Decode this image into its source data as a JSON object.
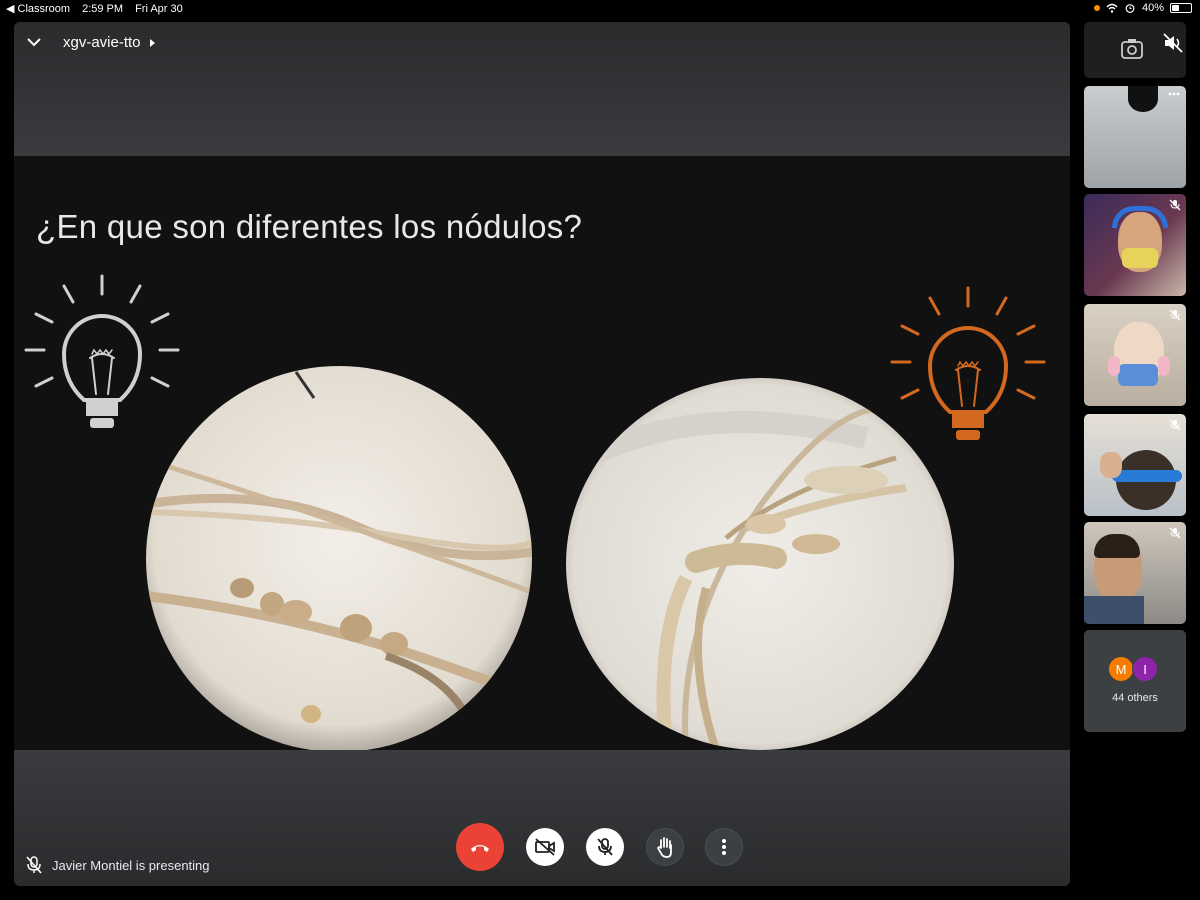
{
  "status_bar": {
    "back_app": "◀ Classroom",
    "time": "2:59 PM",
    "date": "Fri Apr 30",
    "battery": "40%",
    "battery_level": 0.4
  },
  "meeting": {
    "code": "xgv-avie-tto"
  },
  "slide": {
    "title": "¿En que son diferentes los nódulos?",
    "bulb_left_color": "#d0d0d0",
    "bulb_right_color": "#d2691e"
  },
  "presenter": {
    "text": "Javier Montiel is presenting"
  },
  "controls": {
    "end_color": "#ea4335",
    "icons": [
      "phone-hangup-icon",
      "camera-off-icon",
      "mic-off-icon",
      "raise-hand-icon",
      "more-icon"
    ]
  },
  "others": {
    "label": "44 others",
    "avatars": [
      {
        "initial": "M",
        "color": "#f57c00"
      },
      {
        "initial": "I",
        "color": "#8e24aa"
      }
    ]
  }
}
